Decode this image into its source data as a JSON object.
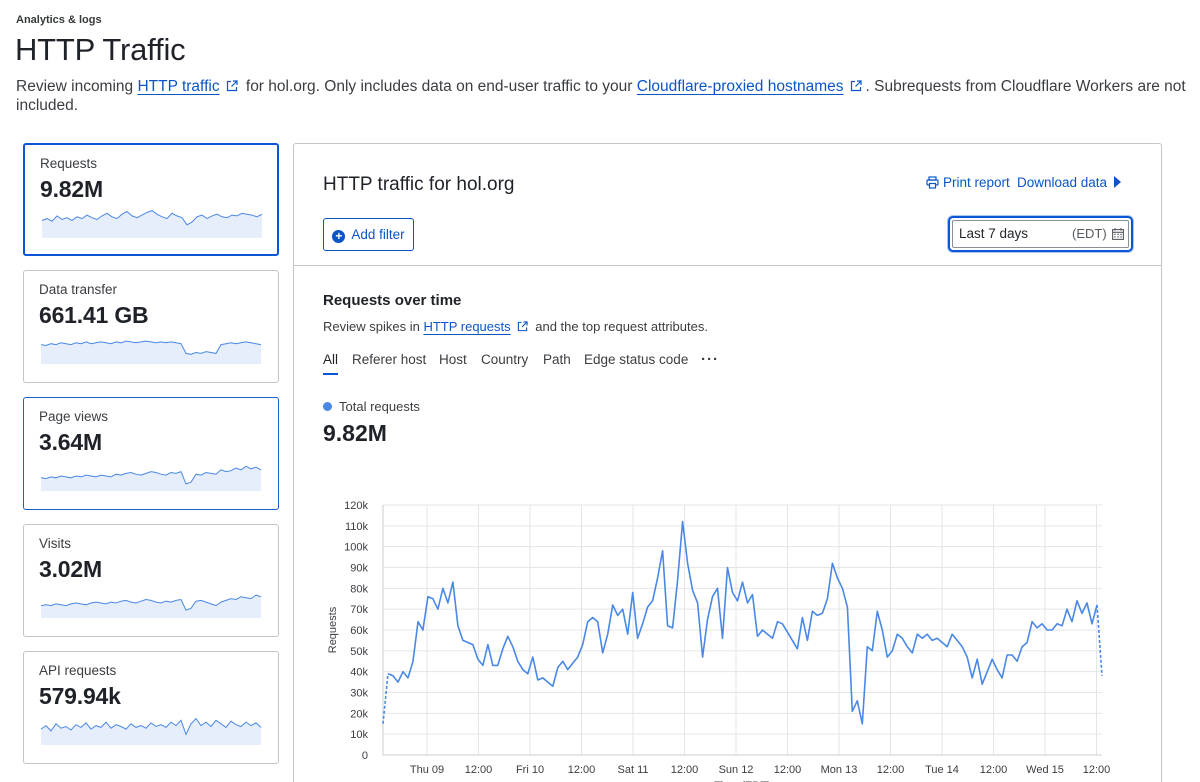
{
  "header": {
    "breadcrumb": "Analytics & logs",
    "title": "HTTP Traffic",
    "desc_prefix": "Review incoming ",
    "desc_link1": "HTTP traffic",
    "desc_middle": " for hol.org. Only includes data on end-user traffic to your ",
    "desc_link2": "Cloudflare-proxied hostnames",
    "desc_suffix": ". Subrequests from Cloudflare Workers are not included."
  },
  "metrics": [
    {
      "label": "Requests",
      "value": "9.82M",
      "spark": [
        20,
        22,
        19,
        25,
        21,
        23,
        20,
        24,
        22,
        26,
        23,
        21,
        25,
        28,
        24,
        22,
        27,
        30,
        25,
        23,
        26,
        29,
        31,
        27,
        24,
        22,
        28,
        25,
        23,
        15,
        18,
        24,
        26,
        22,
        25,
        27,
        24,
        23,
        26,
        25,
        28,
        27,
        26,
        24,
        27
      ]
    },
    {
      "label": "Data transfer",
      "value": "661.41 GB",
      "spark": [
        22,
        21,
        23,
        22,
        24,
        23,
        22,
        24,
        23,
        25,
        23,
        24,
        25,
        24,
        23,
        25,
        24,
        26,
        25,
        24,
        25,
        26,
        25,
        24,
        25,
        24,
        25,
        24,
        23,
        12,
        11,
        13,
        12,
        14,
        13,
        12,
        22,
        23,
        24,
        23,
        24,
        25,
        24,
        23,
        22
      ]
    },
    {
      "label": "Page views",
      "value": "3.64M",
      "spark": [
        15,
        14,
        16,
        15,
        17,
        16,
        15,
        17,
        16,
        18,
        17,
        16,
        18,
        17,
        16,
        19,
        18,
        20,
        21,
        19,
        18,
        20,
        22,
        21,
        19,
        18,
        21,
        20,
        22,
        8,
        10,
        19,
        18,
        21,
        20,
        19,
        24,
        22,
        23,
        26,
        24,
        28,
        25,
        27,
        24
      ]
    },
    {
      "label": "Visits",
      "value": "3.02M",
      "spark": [
        14,
        15,
        14,
        16,
        15,
        14,
        16,
        17,
        16,
        15,
        17,
        18,
        17,
        16,
        18,
        17,
        19,
        20,
        18,
        17,
        19,
        21,
        20,
        18,
        17,
        19,
        18,
        20,
        21,
        9,
        11,
        19,
        20,
        18,
        16,
        14,
        18,
        20,
        22,
        21,
        24,
        23,
        22,
        26,
        24
      ]
    },
    {
      "label": "API requests",
      "value": "579.94k",
      "spark": [
        18,
        22,
        16,
        24,
        19,
        21,
        17,
        23,
        20,
        25,
        18,
        22,
        20,
        26,
        19,
        23,
        21,
        18,
        24,
        20,
        22,
        19,
        25,
        21,
        23,
        20,
        26,
        22,
        28,
        12,
        24,
        30,
        22,
        26,
        21,
        28,
        24,
        20,
        27,
        23,
        21,
        26,
        22,
        25,
        20
      ]
    }
  ],
  "panel": {
    "title": "HTTP traffic for hol.org",
    "print_label": "Print report",
    "download_label": "Download data",
    "add_filter_label": "Add filter",
    "date_range": "Last 7 days",
    "timezone": "(EDT)",
    "section_title": "Requests over time",
    "section_desc_prefix": "Review spikes in ",
    "section_desc_link": "HTTP requests",
    "section_desc_suffix": " and the top request attributes.",
    "tabs": [
      "All",
      "Referer host",
      "Host",
      "Country",
      "Path",
      "Edge status code"
    ],
    "more_label": "···",
    "legend_label": "Total requests",
    "total_value": "9.82M"
  },
  "colors": {
    "accent": "#0b55d6",
    "link": "#0a56c7",
    "series": "#4a88e5"
  },
  "chart_data": {
    "type": "line",
    "ylabel": "Requests",
    "xlabel": "Time (EDT)",
    "ylim": [
      0,
      120000
    ],
    "yticks": [
      "0",
      "10k",
      "20k",
      "30k",
      "40k",
      "50k",
      "60k",
      "70k",
      "80k",
      "90k",
      "100k",
      "110k",
      "120k"
    ],
    "xticks": [
      "Thu 09",
      "12:00",
      "Fri 10",
      "12:00",
      "Sat 11",
      "12:00",
      "Sun 12",
      "12:00",
      "Mon 13",
      "12:00",
      "Tue 14",
      "12:00",
      "Wed 15",
      "12:00"
    ],
    "grid": true,
    "series": [
      {
        "name": "Total requests",
        "values": [
          15000,
          39000,
          38000,
          35000,
          40000,
          37000,
          45000,
          64000,
          60000,
          76000,
          75000,
          70000,
          80000,
          73000,
          83000,
          62000,
          55000,
          54000,
          53000,
          46000,
          43000,
          53000,
          43000,
          43000,
          51000,
          57000,
          52000,
          45000,
          41000,
          39000,
          47000,
          36000,
          37000,
          35000,
          33000,
          42000,
          45000,
          41000,
          44000,
          47000,
          53000,
          64000,
          66000,
          64000,
          49000,
          58000,
          72000,
          67000,
          70000,
          58000,
          78000,
          56000,
          63000,
          71000,
          74000,
          85000,
          98000,
          62000,
          61000,
          84000,
          112000,
          92000,
          79000,
          73000,
          47000,
          65000,
          76000,
          80000,
          56000,
          90000,
          78000,
          74000,
          83000,
          73000,
          77000,
          57000,
          60000,
          58000,
          56000,
          64000,
          63000,
          59000,
          55000,
          51000,
          66000,
          55000,
          69000,
          67000,
          68000,
          75000,
          92000,
          85000,
          80000,
          71000,
          21000,
          26000,
          15000,
          52000,
          50000,
          69000,
          60000,
          47000,
          50000,
          58000,
          56000,
          52000,
          49000,
          58000,
          56000,
          58000,
          55000,
          56000,
          54000,
          52000,
          58000,
          55000,
          52000,
          47000,
          37000,
          46000,
          34000,
          40000,
          46000,
          41000,
          37000,
          48000,
          48000,
          45000,
          52000,
          54000,
          64000,
          61000,
          63000,
          60000,
          60000,
          63000,
          62000,
          70000,
          64000,
          74000,
          68000,
          73000,
          63000,
          72000,
          38000
        ]
      }
    ]
  }
}
